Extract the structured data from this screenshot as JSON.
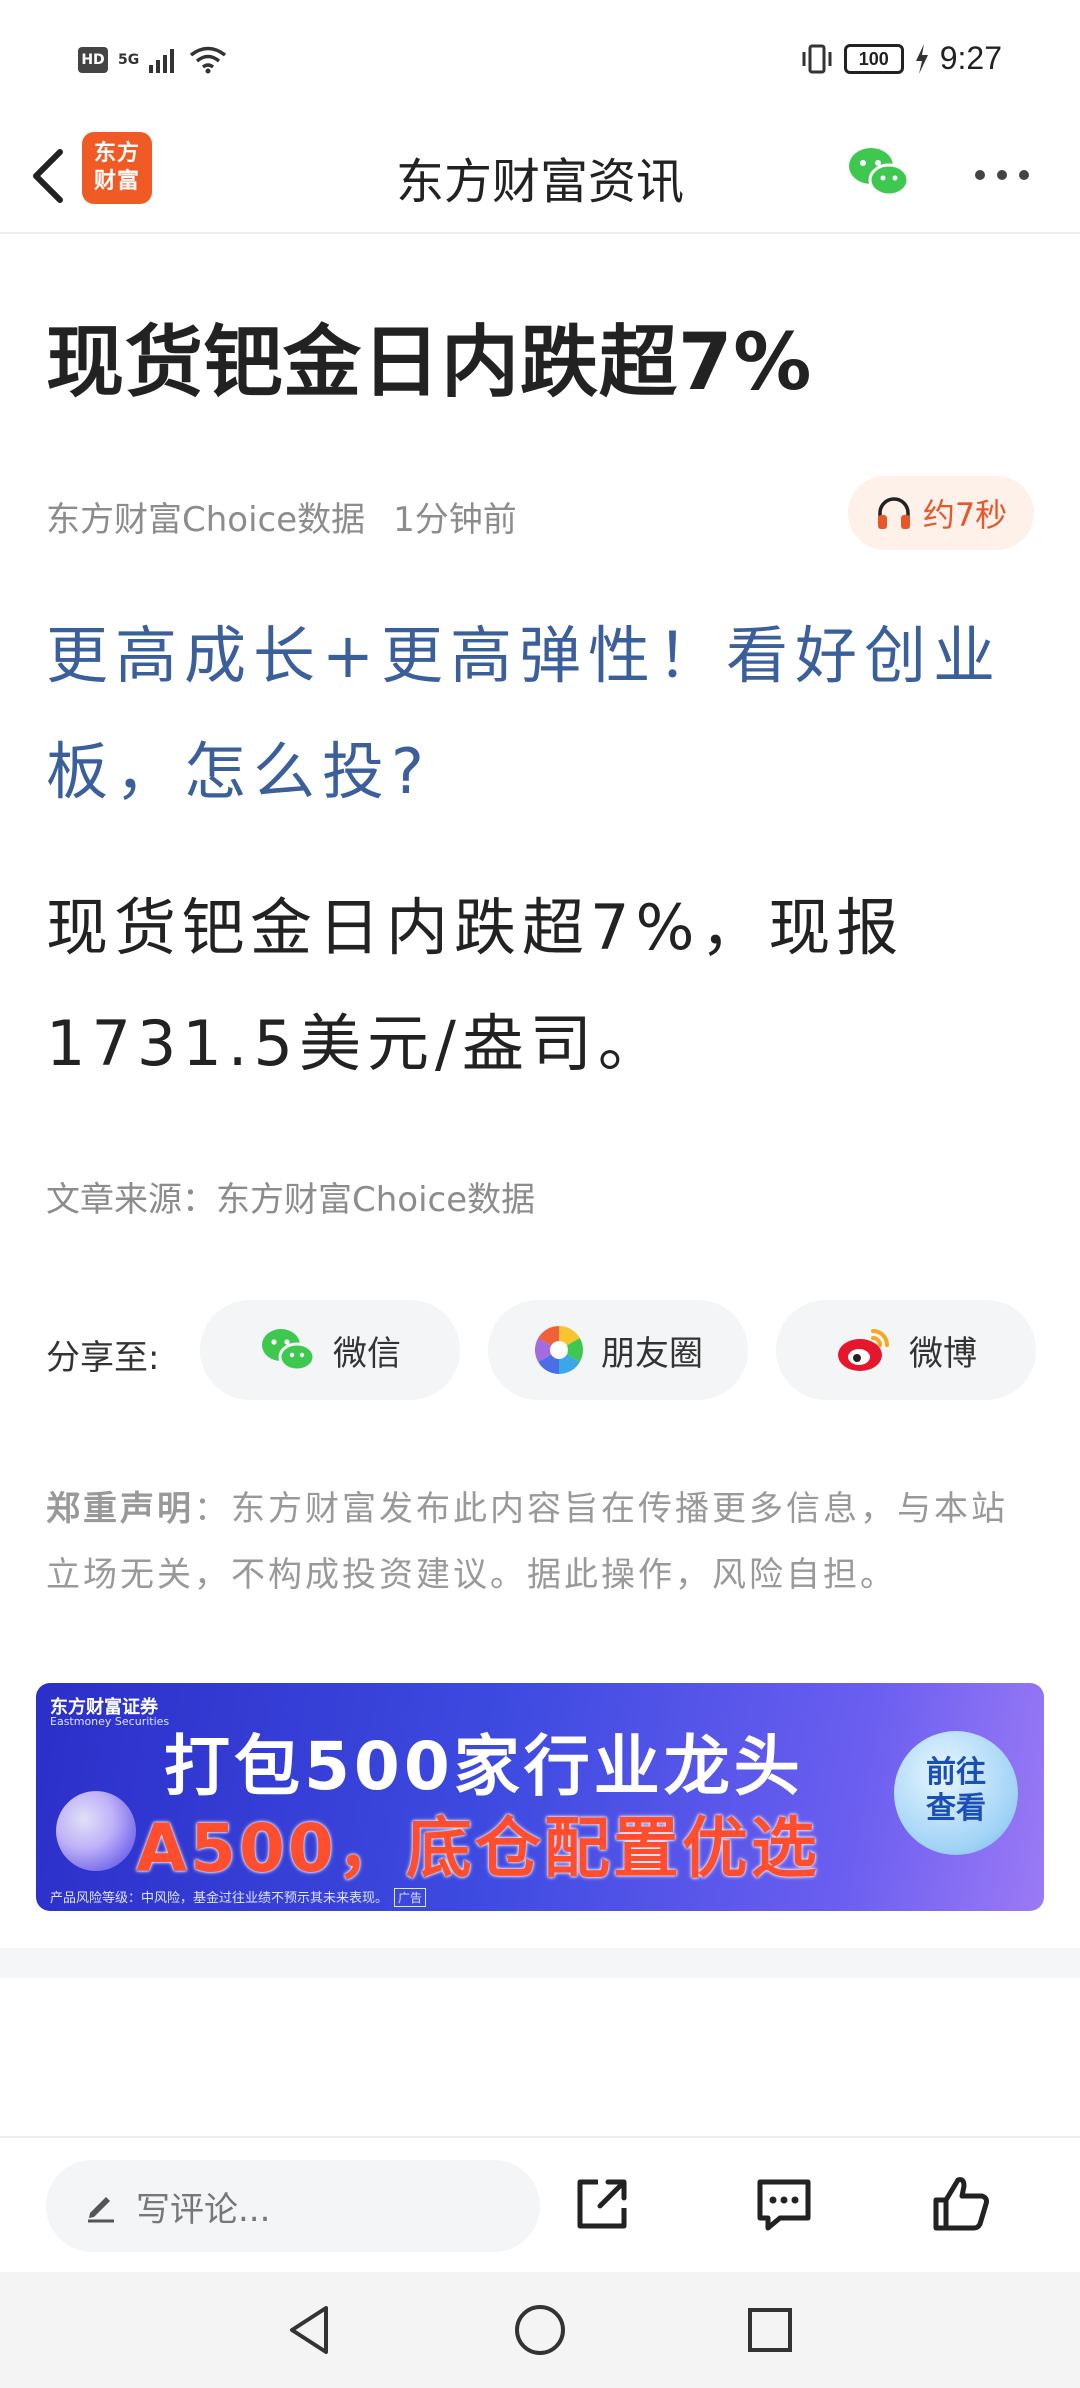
{
  "status_bar": {
    "hd": "HD",
    "network": "5G",
    "battery": "100",
    "time": "9:27"
  },
  "navbar": {
    "logo_text_line1": "东方",
    "logo_text_line2": "财富",
    "title": "东方财富资讯"
  },
  "article": {
    "headline": "现货钯金日内跌超7%",
    "author": "东方财富Choice数据",
    "time_ago": "1分钟前",
    "audio_duration": "约7秒",
    "related_link": "更高成长+更高弹性！看好创业板，怎么投?",
    "body": "现货钯金日内跌超7%，现报1731.5美元/盎司。",
    "source": "文章来源：东方财富Choice数据"
  },
  "share": {
    "label": "分享至:",
    "wechat": "微信",
    "moments": "朋友圈",
    "weibo": "微博"
  },
  "disclaimer": {
    "title": "郑重声明",
    "text": "：东方财富发布此内容旨在传播更多信息，与本站立场无关，不构成投资建议。据此操作，风险自担。"
  },
  "ad": {
    "brand": "东方财富证券",
    "brand_en": "Eastmoney Securities",
    "line1": "打包500家行业龙头",
    "line2": "A500，底仓配置优选",
    "cta_line1": "前往",
    "cta_line2": "查看",
    "risk_note": "产品风险等级：中风险，基金过往业绩不预示其未来表现。",
    "tag": "广告"
  },
  "bottom_bar": {
    "comment_placeholder": "写评论..."
  },
  "colors": {
    "accent_orange": "#f05a24",
    "link_blue": "#3a5f9b",
    "wechat_green": "#3fc84f"
  }
}
